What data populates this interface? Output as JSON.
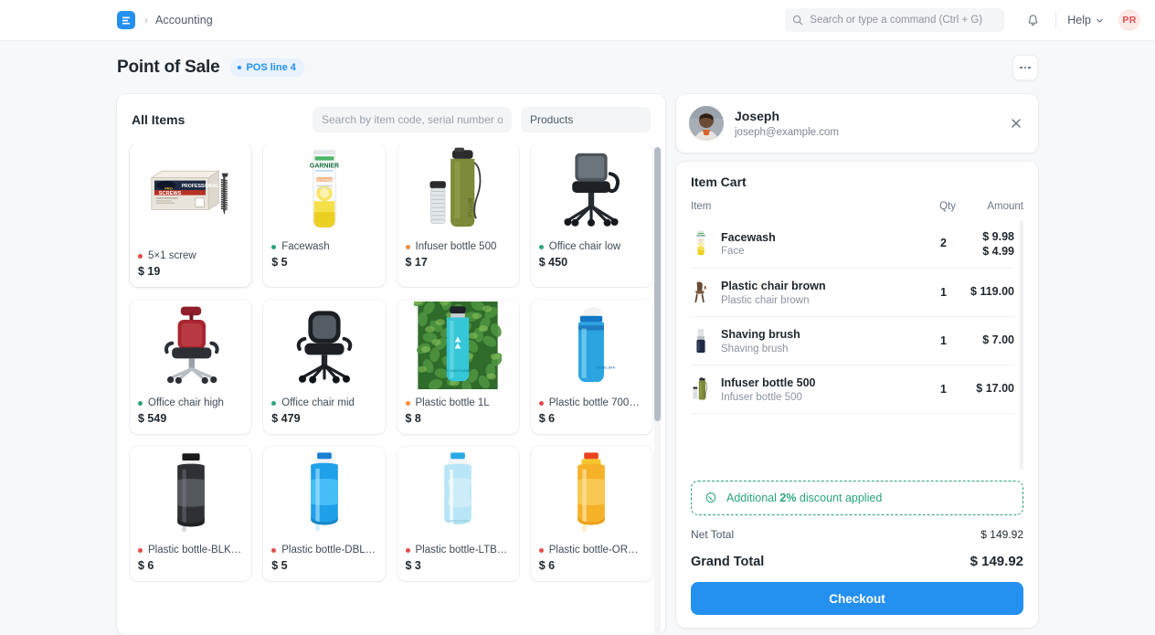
{
  "navbar": {
    "logo_text": "E",
    "breadcrumb": "Accounting",
    "search_placeholder": "Search or type a command (Ctrl + G)",
    "bell_icon": "bell-icon",
    "help_label": "Help",
    "avatar_initials": "PR"
  },
  "page": {
    "title": "Point of Sale",
    "badge": "POS line 4",
    "more_menu": "..."
  },
  "items_panel": {
    "title": "All Items",
    "search_placeholder": "Search by item code, serial number or bar",
    "filter_value": "Products",
    "products": [
      {
        "name": "5×1 screw",
        "price": "$ 19",
        "status": "red",
        "img": "screws-box",
        "selected": true
      },
      {
        "name": "Facewash",
        "price": "$ 5",
        "status": "green",
        "img": "facewash-tube",
        "selected": false
      },
      {
        "name": "Infuser bottle 500",
        "price": "$ 17",
        "status": "orange",
        "img": "infuser-bottle-olive",
        "selected": false
      },
      {
        "name": "Office chair low",
        "price": "$ 450",
        "status": "green",
        "img": "office-chair-black",
        "selected": false
      },
      {
        "name": "Office chair high",
        "price": "$ 549",
        "status": "green",
        "img": "office-chair-red",
        "selected": false
      },
      {
        "name": "Office chair mid",
        "price": "$ 479",
        "status": "green",
        "img": "office-chair-mesh",
        "selected": false
      },
      {
        "name": "Plastic bottle 1L",
        "price": "$ 8",
        "status": "orange",
        "img": "bottle-teal-outdoor",
        "selected": false
      },
      {
        "name": "Plastic bottle 700…",
        "price": "$ 6",
        "status": "red",
        "img": "bottle-blue-sport",
        "selected": false
      },
      {
        "name": "Plastic bottle-BLK…",
        "price": "$ 6",
        "status": "red",
        "img": "bottle-black",
        "selected": false
      },
      {
        "name": "Plastic bottle-DBL…",
        "price": "$ 5",
        "status": "red",
        "img": "bottle-darkblue",
        "selected": false
      },
      {
        "name": "Plastic bottle-LTB…",
        "price": "$ 3",
        "status": "red",
        "img": "bottle-lightblue",
        "selected": false
      },
      {
        "name": "Plastic bottle-ORG…",
        "price": "$ 6",
        "status": "red",
        "img": "bottle-orange",
        "selected": false
      }
    ]
  },
  "customer": {
    "name": "Joseph",
    "email": "joseph@example.com",
    "close_icon": "close-icon"
  },
  "cart": {
    "title": "Item Cart",
    "columns": {
      "item": "Item",
      "qty": "Qty",
      "amount": "Amount"
    },
    "rows": [
      {
        "name": "Facewash",
        "desc": "Face",
        "qty": "2",
        "amount": "$ 9.98",
        "rate": "$ 4.99",
        "thumb": "facewash-tube"
      },
      {
        "name": "Plastic chair brown",
        "desc": "Plastic chair brown",
        "qty": "1",
        "amount": "$ 119.00",
        "rate": "",
        "thumb": "plastic-chair-brown"
      },
      {
        "name": "Shaving brush",
        "desc": "Shaving brush",
        "qty": "1",
        "amount": "$ 7.00",
        "rate": "",
        "thumb": "shaving-brush"
      },
      {
        "name": "Infuser bottle 500",
        "desc": "Infuser bottle 500",
        "qty": "1",
        "amount": "$ 17.00",
        "rate": "",
        "thumb": "infuser-bottle-olive"
      }
    ],
    "discount_prefix": "Additional ",
    "discount_value": "2%",
    "discount_suffix": " discount applied",
    "discount_icon": "discount-badge-icon",
    "net_total_label": "Net Total",
    "net_total_value": "$ 149.92",
    "grand_total_label": "Grand Total",
    "grand_total_value": "$ 149.92",
    "checkout_label": "Checkout"
  },
  "colors": {
    "accent": "#2490ef",
    "green": "#29a47c",
    "red": "#e24c4c",
    "orange": "#f28c3a",
    "page_bg": "#f7f8f9"
  }
}
